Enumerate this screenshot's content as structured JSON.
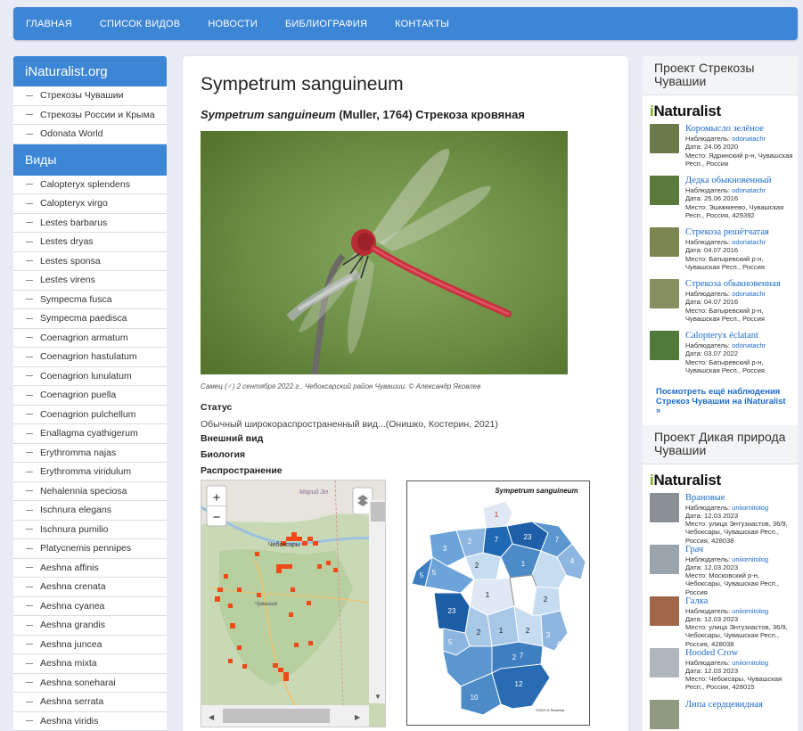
{
  "nav": [
    "ГЛАВНАЯ",
    "СПИСОК ВИДОВ",
    "НОВОСТИ",
    "БИБЛИОГРАФИЯ",
    "КОНТАКТЫ"
  ],
  "left": {
    "heading": "iNaturalist.org",
    "links": [
      "Стрекозы Чувашии",
      "Стрекозы России и Крыма",
      "Odonata World"
    ],
    "species_heading": "Виды",
    "species": [
      "Calopteryx splendens",
      "Calopteryx virgo",
      "Lestes barbarus",
      "Lestes dryas",
      "Lestes sponsa",
      "Lestes virens",
      "Sympecma fusca",
      "Sympecma paedisca",
      "Coenagrion armatum",
      "Coenagrion hastulatum",
      "Coenagrion lunulatum",
      "Coenagrion puella",
      "Coenagrion pulchellum",
      "Enallagma cyathigerum",
      "Erythromma najas",
      "Erythromma viridulum",
      "Nehalennia speciosa",
      "Ischnura elegans",
      "Ischnura pumilio",
      "Platycnemis pennipes",
      "Aeshna affinis",
      "Aeshna crenata",
      "Aeshna cyanea",
      "Aeshna grandis",
      "Aeshna juncea",
      "Aeshna mixta",
      "Aeshna soneharai",
      "Aeshna serrata",
      "Aeshna viridis"
    ]
  },
  "main": {
    "title": "Sympetrum sanguineum",
    "subtitle_latin": "Sympetrum sanguineum",
    "subtitle_rest": " (Muller, 1764) Стрекоза кровяная",
    "caption": "Самец (♂) 2 сентября 2022 г., Чебоксарский район Чувашии. © Александр Яковлев",
    "status_label": "Статус",
    "status_text": "Обычный широкораспространенный вид...(Онишко, Костерин, 2021)",
    "appearance_label": "Внешний вид",
    "biology_label": "Биология",
    "distribution_label": "Распространение",
    "map_zoom_in": "+",
    "map_zoom_out": "−",
    "map_city_1": "Марий Эл",
    "map_city_2": "Чебоксары",
    "map_city_3": "Чувашия",
    "choropleth_title": "Sympetrum sanguineum",
    "choropleth_numbers": [
      "1",
      "7",
      "23",
      "7",
      "2",
      "4",
      "3",
      "2",
      "1",
      "5",
      "8",
      "5",
      "1",
      "2",
      "23",
      "1",
      "2",
      "2",
      "3",
      "5",
      "2",
      "4",
      "7",
      "10",
      "12"
    ],
    "choropleth_credit": "©2023 А.Яковлев"
  },
  "right": {
    "project1_heading": "Проект Стрекозы Чувашии",
    "logo_prefix": "i",
    "logo_rest": "Naturalist",
    "observations1": [
      {
        "title": "Коромысло зелёное",
        "observer_label": "Наблюдатель: ",
        "observer": "odonatachr",
        "date": "Дата: 24.06 2020",
        "place": "Место: Ядринский р-н, Чувашская Респ., Россия",
        "color": "#6b7a4a"
      },
      {
        "title": "Дедка обыкновенный",
        "observer_label": "Наблюдатель: ",
        "observer": "odonatachr",
        "date": "Дата: 25.06 2016",
        "place": "Место: Эшмикеево, Чувашская Респ., Россия, 429392",
        "color": "#5a7a3c"
      },
      {
        "title": "Стрекоза решётчатая",
        "observer_label": "Наблюдатель: ",
        "observer": "odonatachr",
        "date": "Дата: 04.07 2016",
        "place": "Место: Батыревский р-н, Чувашская Респ., Россия",
        "color": "#7c8650"
      },
      {
        "title": "Стрекоза обыкновенная",
        "observer_label": "Наблюдатель: ",
        "observer": "odonatachr",
        "date": "Дата: 04.07 2016",
        "place": "Место: Батыревский р-н, Чувашская Респ., Россия",
        "color": "#879060"
      },
      {
        "title": "Calopteryx éclatant",
        "observer_label": "Наблюдатель: ",
        "observer": "odonatachr",
        "date": "Дата: 03.07 2022",
        "place": "Место: Батыревский р-н, Чувашская Респ., Россия",
        "color": "#4f7a3a"
      }
    ],
    "more_link": "Посмотреть ещё наблюдения Стрекоз Чувашии на iNaturalist »",
    "project2_heading": "Проект Дикая природа Чувашии",
    "observations2": [
      {
        "title": "Врановые",
        "observer_label": "Наблюдатель: ",
        "observer": "uniiornitolog",
        "date": "Дата: 12.03 2023",
        "place": "Место: улица Энтузиастов, 36/9, Чебоксары, Чувашская Респ., Россия, 428038",
        "color": "#8a8f95"
      },
      {
        "title": "Грач",
        "observer_label": "Наблюдатель: ",
        "observer": "uniiornitolog",
        "date": "Дата: 12.03 2023",
        "place": "Место: Московский р-н, Чебоксары, Чувашская Респ., Россия",
        "color": "#9aa4ad"
      },
      {
        "title": "Галка",
        "observer_label": "Наблюдатель: ",
        "observer": "uniiornitolog",
        "date": "Дата: 12.03 2023",
        "place": "Место: улица Энтузиастов, 36/9, Чебоксары, Чувашская Респ., Россия, 428038",
        "color": "#a0664a"
      },
      {
        "title": "Hooded Crow",
        "observer_label": "Наблюдатель: ",
        "observer": "uniiornitolog",
        "date": "Дата: 12.03 2023",
        "place": "Место: Чебоксары, Чувашская Респ., Россия, 428015",
        "color": "#b0b6bd"
      },
      {
        "title": "Липа сердцевидная",
        "observer_label": "",
        "observer": "",
        "date": "",
        "place": "",
        "color": "#8f9a80"
      }
    ]
  }
}
